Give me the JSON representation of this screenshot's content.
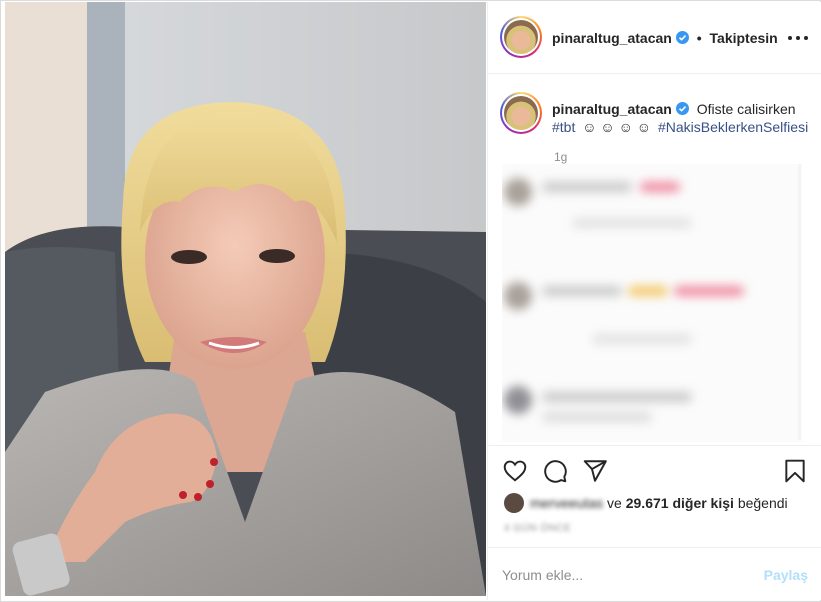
{
  "post": {
    "username": "pinaraltug_atacan",
    "verified": true,
    "separator": "•",
    "follow_status": "Takiptesin",
    "more_icon": "more-horizontal-icon"
  },
  "caption": {
    "username": "pinaraltug_atacan",
    "text": "Ofiste calisirken",
    "hashtag1": "#tbt",
    "emojis": "☺ ☺ ☺ ☺",
    "hashtag2": "#NakisBeklerkenSelfiesi",
    "time": "1g"
  },
  "actions": {
    "like_icon": "heart-icon",
    "comment_icon": "comment-icon",
    "share_icon": "paper-plane-icon",
    "save_icon": "bookmark-icon"
  },
  "likes": {
    "first_user": "merveeutas",
    "connector": "ve",
    "count": "29.671 diğer kişi",
    "suffix": "beğendi"
  },
  "date_text": "4 GÜN ÖNCE",
  "comment": {
    "placeholder": "Yorum ekle...",
    "post_label": "Paylaş"
  },
  "colors": {
    "link": "#385185",
    "post_button_disabled": "#b2dffc",
    "verified_badge": "#3897f0"
  }
}
